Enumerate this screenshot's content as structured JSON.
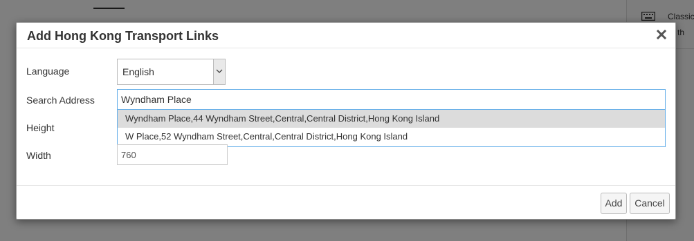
{
  "background": {
    "right_panel_title": "Classic",
    "right_panel_sub": "se th"
  },
  "modal": {
    "title": "Add Hong Kong Transport Links",
    "close_icon": "close-icon"
  },
  "form": {
    "language_label": "Language",
    "language_value": "English",
    "search_label": "Search Address",
    "search_value": "Wyndham Place",
    "height_label": "Height",
    "width_label": "Width",
    "width_value": "760"
  },
  "suggestions": [
    {
      "text": "Wyndham Place,44 Wyndham Street,Central,Central District,Hong Kong Island"
    },
    {
      "text": "W Place,52 Wyndham Street,Central,Central District,Hong Kong Island"
    }
  ],
  "footer": {
    "add_label": "Add",
    "cancel_label": "Cancel"
  }
}
